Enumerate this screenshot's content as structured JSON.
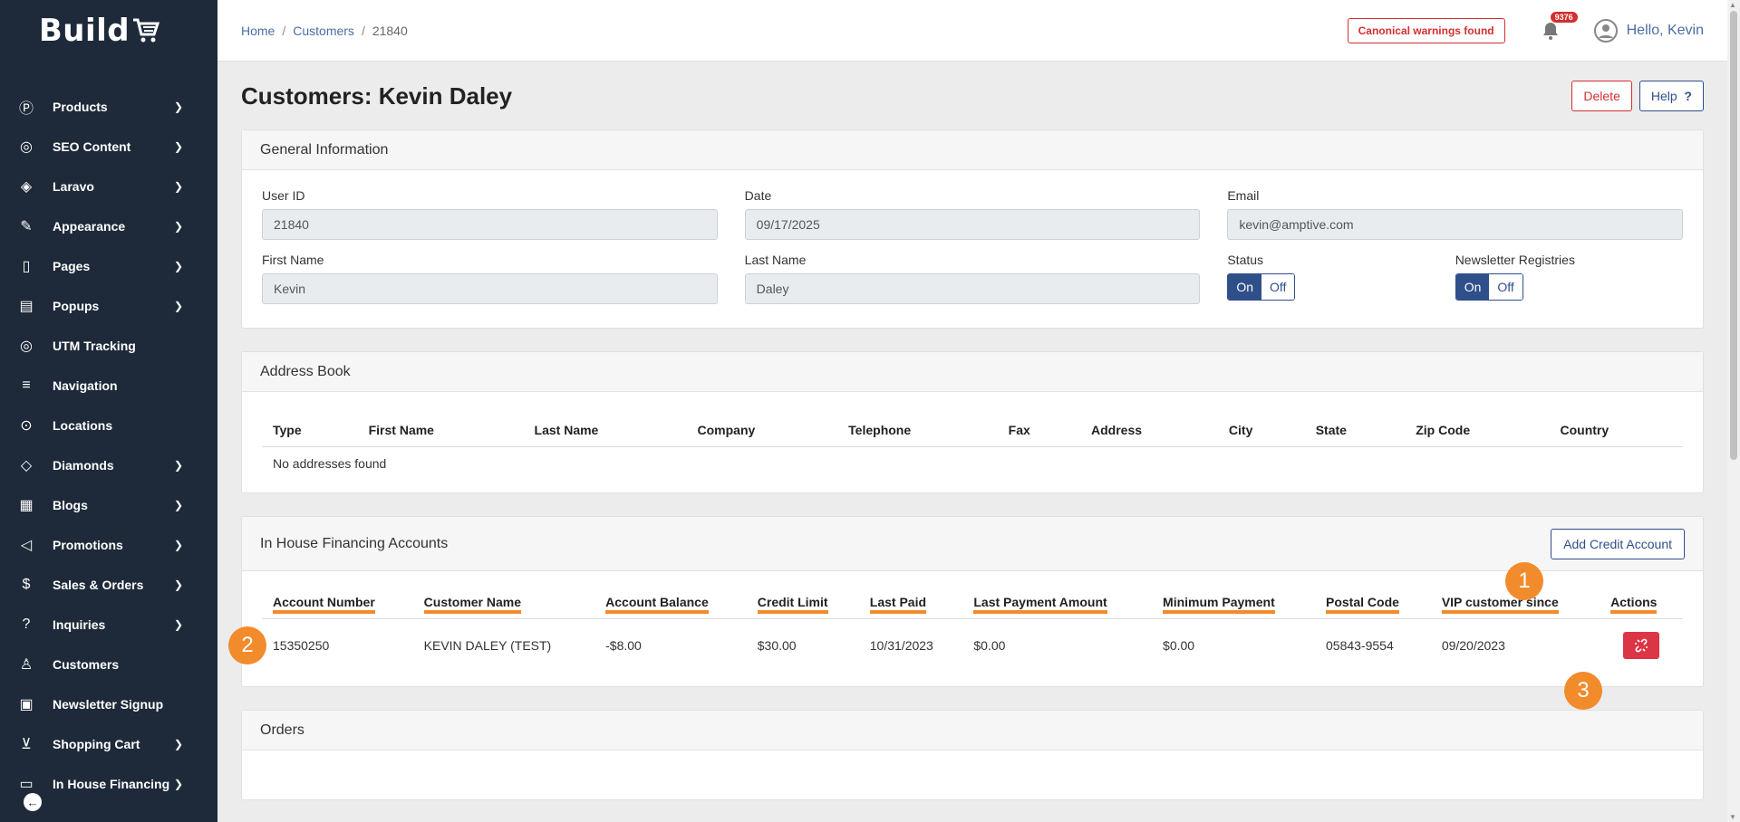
{
  "app": {
    "logo_text": "Build"
  },
  "sidebar": {
    "items": [
      {
        "label": "Products",
        "icon": "product-icon",
        "has_submenu": true
      },
      {
        "label": "SEO Content",
        "icon": "seo-icon",
        "has_submenu": true
      },
      {
        "label": "Laravo",
        "icon": "layers-icon",
        "has_submenu": true
      },
      {
        "label": "Appearance",
        "icon": "brush-icon",
        "has_submenu": true
      },
      {
        "label": "Pages",
        "icon": "page-icon",
        "has_submenu": true
      },
      {
        "label": "Popups",
        "icon": "popup-icon",
        "has_submenu": true
      },
      {
        "label": "UTM Tracking",
        "icon": "utm-icon",
        "has_submenu": false
      },
      {
        "label": "Navigation",
        "icon": "menu-icon",
        "has_submenu": false
      },
      {
        "label": "Locations",
        "icon": "map-pin-icon",
        "has_submenu": false
      },
      {
        "label": "Diamonds",
        "icon": "diamond-icon",
        "has_submenu": true
      },
      {
        "label": "Blogs",
        "icon": "blog-icon",
        "has_submenu": true
      },
      {
        "label": "Promotions",
        "icon": "megaphone-icon",
        "has_submenu": true
      },
      {
        "label": "Sales & Orders",
        "icon": "dollar-icon",
        "has_submenu": true
      },
      {
        "label": "Inquiries",
        "icon": "question-icon",
        "has_submenu": true
      },
      {
        "label": "Customers",
        "icon": "user-icon",
        "has_submenu": false
      },
      {
        "label": "Newsletter Signup",
        "icon": "newsletter-icon",
        "has_submenu": false
      },
      {
        "label": "Shopping Cart",
        "icon": "cart-icon",
        "has_submenu": true
      },
      {
        "label": "In House Financing",
        "icon": "finance-icon",
        "has_submenu": true
      }
    ]
  },
  "topbar": {
    "breadcrumb": [
      "Home",
      "Customers",
      "21840"
    ],
    "warning": "Canonical warnings found",
    "notification_count": "9376",
    "greeting": "Hello, Kevin"
  },
  "page": {
    "title": "Customers: Kevin Daley",
    "delete_label": "Delete",
    "help_label": "Help"
  },
  "general": {
    "heading": "General Information",
    "user_id_label": "User ID",
    "user_id": "21840",
    "date_label": "Date",
    "date": "09/17/2025",
    "email_label": "Email",
    "email": "kevin@amptive.com",
    "first_name_label": "First Name",
    "first_name": "Kevin",
    "last_name_label": "Last Name",
    "last_name": "Daley",
    "status_label": "Status",
    "newsletter_label": "Newsletter Registries",
    "on_label": "On",
    "off_label": "Off"
  },
  "address_book": {
    "heading": "Address Book",
    "columns": [
      "Type",
      "First Name",
      "Last Name",
      "Company",
      "Telephone",
      "Fax",
      "Address",
      "City",
      "State",
      "Zip Code",
      "Country"
    ],
    "empty": "No addresses found"
  },
  "financing": {
    "heading": "In House Financing Accounts",
    "add_label": "Add Credit Account",
    "columns": [
      "Account Number",
      "Customer Name",
      "Account Balance",
      "Credit Limit",
      "Last Paid",
      "Last Payment Amount",
      "Minimum Payment",
      "Postal Code",
      "VIP customer since",
      "Actions"
    ],
    "rows": [
      [
        "15350250",
        "KEVIN DALEY (TEST)",
        "-$8.00",
        "$30.00",
        "10/31/2023",
        "$0.00",
        "$0.00",
        "05843-9554",
        "09/20/2023"
      ]
    ]
  },
  "orders": {
    "heading": "Orders"
  },
  "markers": [
    "1",
    "2",
    "3"
  ],
  "colors": {
    "sidebar": "#1e2a3a",
    "primary": "#2f4f8a",
    "danger": "#dc3545",
    "highlight": "#f28b2c"
  }
}
